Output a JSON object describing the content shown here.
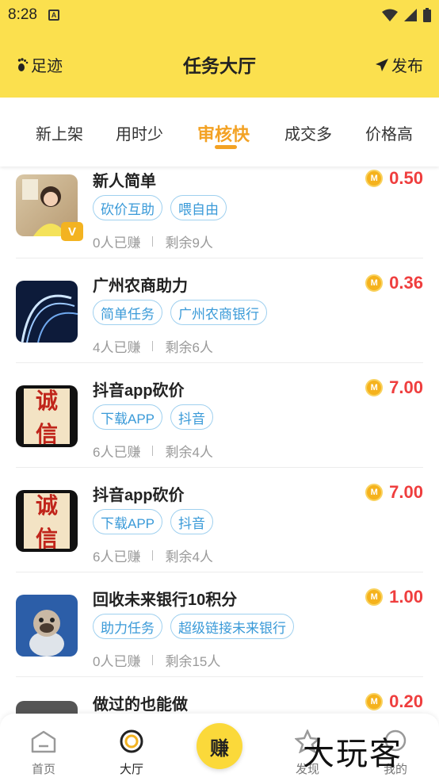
{
  "status_bar": {
    "time": "8:28"
  },
  "header": {
    "left_label": "足迹",
    "title": "任务大厅",
    "right_label": "发布"
  },
  "tabs": [
    {
      "label": "新上架",
      "active": false
    },
    {
      "label": "用时少",
      "active": false
    },
    {
      "label": "审核快",
      "active": true
    },
    {
      "label": "成交多",
      "active": false
    },
    {
      "label": "价格高",
      "active": false
    }
  ],
  "tasks": [
    {
      "title": "新人简单",
      "tags": [
        "砍价互助",
        "喂自由"
      ],
      "earned": "0人已赚",
      "remaining": "剩余9人",
      "price": "0.50"
    },
    {
      "title": "广州农商助力",
      "tags": [
        "简单任务",
        "广州农商银行"
      ],
      "earned": "4人已赚",
      "remaining": "剩余6人",
      "price": "0.36"
    },
    {
      "title": "抖音app砍价",
      "tags": [
        "下载APP",
        "抖音"
      ],
      "earned": "6人已赚",
      "remaining": "剩余4人",
      "price": "7.00"
    },
    {
      "title": "抖音app砍价",
      "tags": [
        "下载APP",
        "抖音"
      ],
      "earned": "6人已赚",
      "remaining": "剩余4人",
      "price": "7.00"
    },
    {
      "title": "回收未来银行10积分",
      "tags": [
        "助力任务",
        "超级链接未来银行"
      ],
      "earned": "0人已赚",
      "remaining": "剩余15人",
      "price": "1.00"
    },
    {
      "title": "做过的也能做",
      "tags": [],
      "earned": "",
      "remaining": "",
      "price": "0.20"
    }
  ],
  "thumb_text": {
    "seal_top": "诚",
    "seal_bottom": "信"
  },
  "coin_glyph": "M",
  "nav": [
    {
      "label": "首页",
      "active": false
    },
    {
      "label": "大厅",
      "active": true
    },
    {
      "label": "赚",
      "center": true
    },
    {
      "label": "发现",
      "active": false
    },
    {
      "label": "我的",
      "active": false
    }
  ],
  "watermark": "大玩客",
  "colors": {
    "header_bg": "#fbe04e",
    "accent": "#f3a224",
    "price": "#ef3e3e",
    "tag": "#3a9ad8"
  }
}
